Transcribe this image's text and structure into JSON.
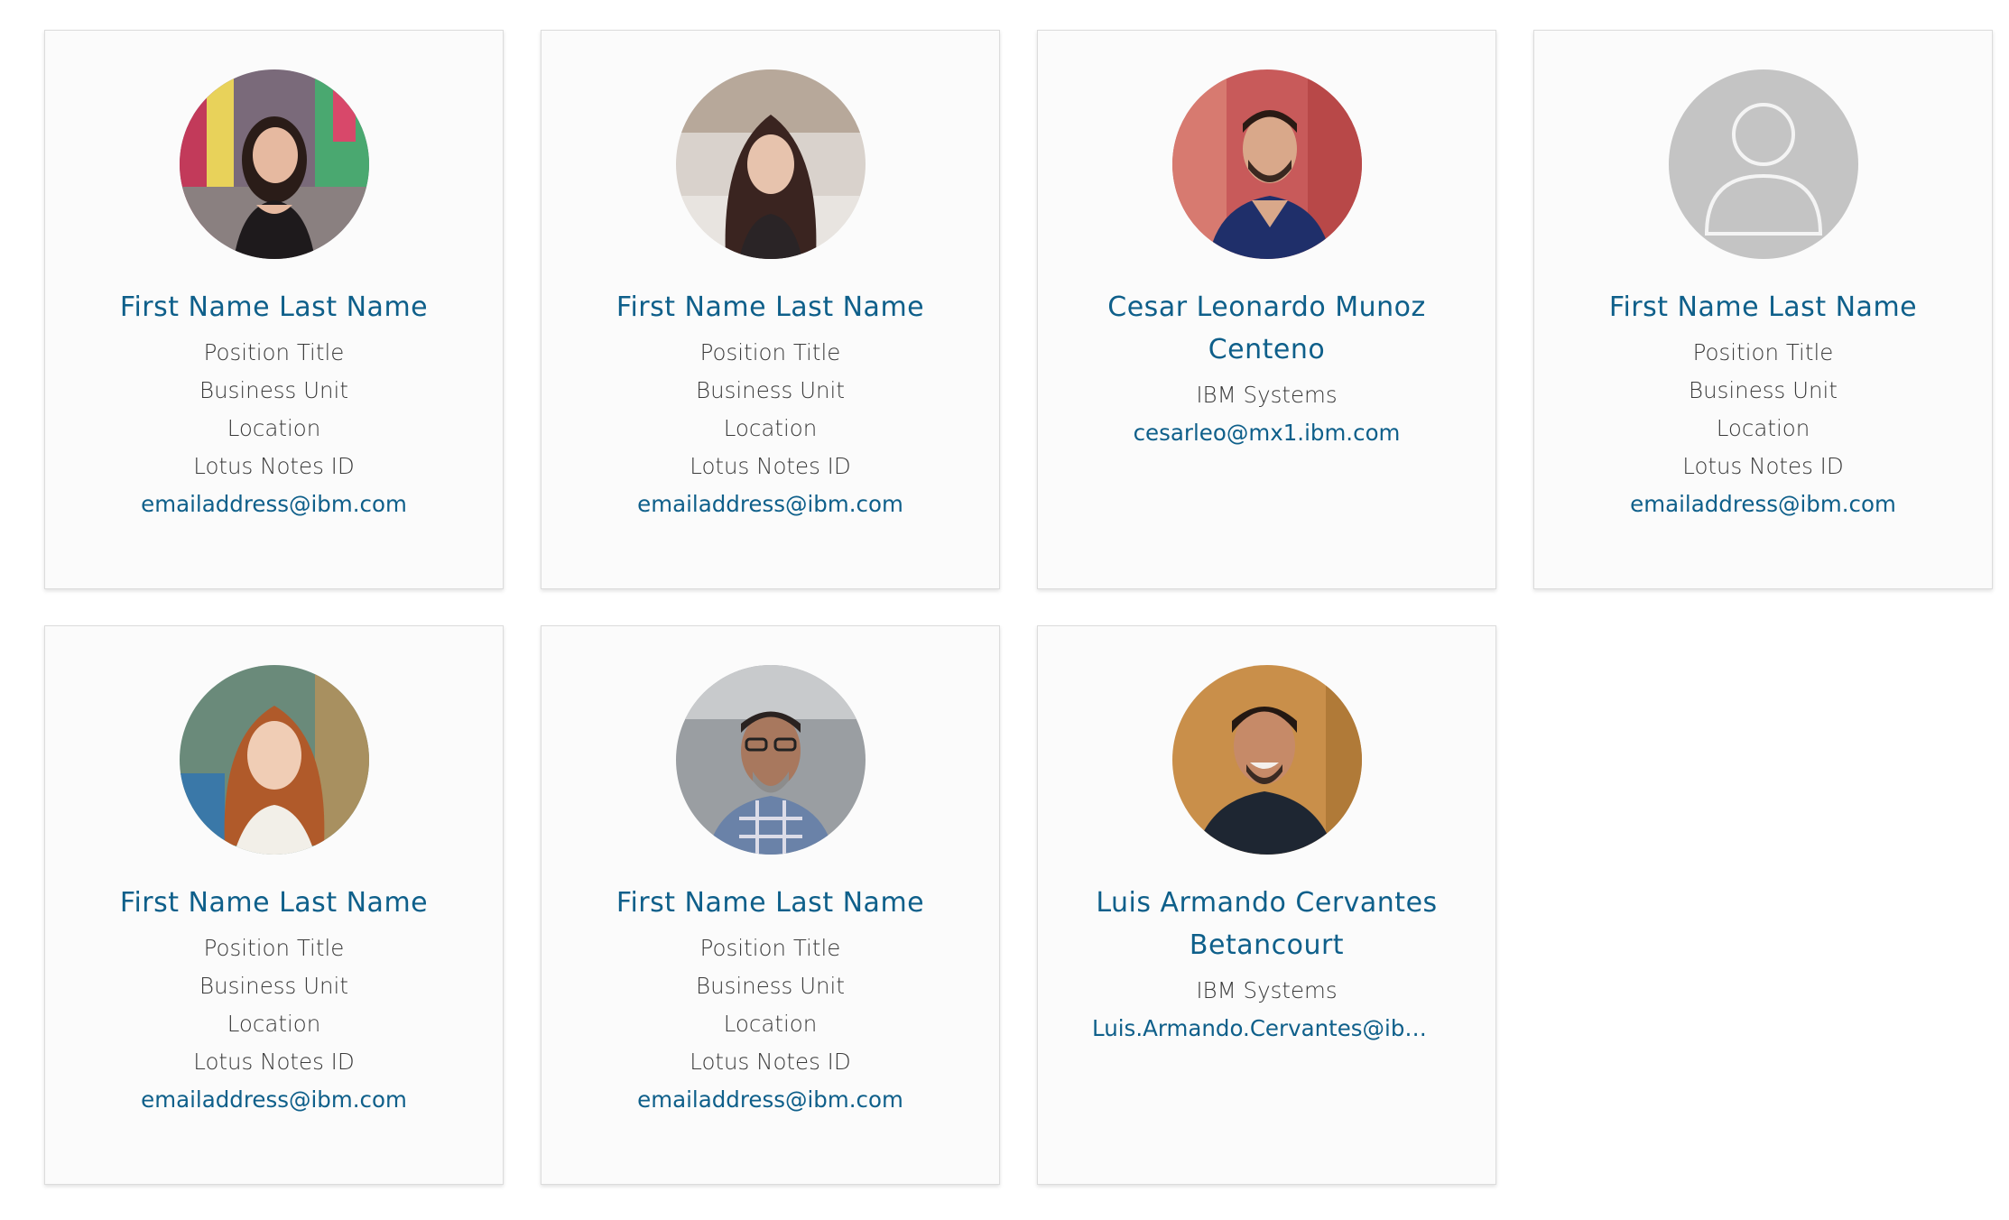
{
  "cards": [
    {
      "avatar": "person-photo-woman-city",
      "name": "First Name Last Name",
      "position": "Position Title",
      "business_unit": "Business Unit",
      "location": "Location",
      "notes_id": "Lotus Notes ID",
      "email": "emailaddress@ibm.com"
    },
    {
      "avatar": "person-photo-woman-outdoor",
      "name": "First Name Last Name",
      "position": "Position Title",
      "business_unit": "Business Unit",
      "location": "Location",
      "notes_id": "Lotus Notes ID",
      "email": "emailaddress@ibm.com"
    },
    {
      "avatar": "person-photo-man-red-background",
      "name": "Cesar Leonardo Munoz Centeno",
      "business_unit": "IBM Systems",
      "email": "cesarleo@mx1.ibm.com"
    },
    {
      "avatar": "user-placeholder-icon",
      "name": "First Name Last Name",
      "position": "Position Title",
      "business_unit": "Business Unit",
      "location": "Location",
      "notes_id": "Lotus Notes ID",
      "email": "emailaddress@ibm.com"
    },
    {
      "avatar": "person-photo-woman-redhair",
      "name": "First Name Last Name",
      "position": "Position Title",
      "business_unit": "Business Unit",
      "location": "Location",
      "notes_id": "Lotus Notes ID",
      "email": "emailaddress@ibm.com"
    },
    {
      "avatar": "person-photo-man-glasses",
      "name": "First Name Last Name",
      "position": "Position Title",
      "business_unit": "Business Unit",
      "location": "Location",
      "notes_id": "Lotus Notes ID",
      "email": "emailaddress@ibm.com"
    },
    {
      "avatar": "person-photo-man-smiling",
      "name": "Luis Armando Cervantes Betancourt",
      "business_unit": "IBM Systems",
      "email": "Luis.Armando.Cervantes@ibm.com"
    }
  ],
  "colors": {
    "link": "#0e5f8a",
    "text": "#3a3a3a",
    "card_bg": "#fbfbfb",
    "card_border": "#dcdcdc",
    "placeholder_bg": "#c4c4c4"
  }
}
